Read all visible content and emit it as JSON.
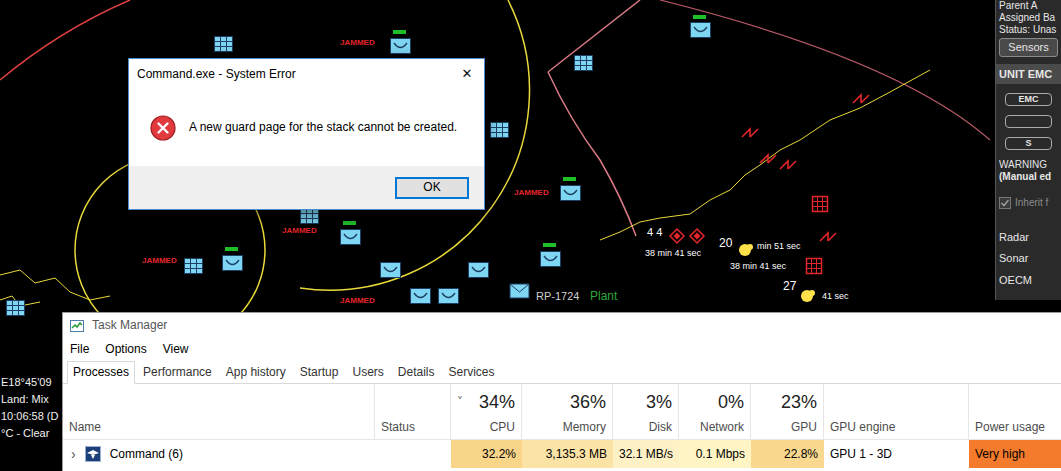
{
  "map": {
    "labels": [
      {
        "text": "JAMMED",
        "color": "#e3262b"
      },
      {
        "text": "JAMMED",
        "color": "#e3262b"
      },
      {
        "text": "JAMMED",
        "color": "#e3262b"
      },
      {
        "text": "JAMMED",
        "color": "#e3262b"
      },
      {
        "text": "JAMMED",
        "color": "#e3262b"
      },
      {
        "text": "RP-1724",
        "color": "#d0d0d0"
      },
      {
        "text": "Plant",
        "color": "#2fa83a"
      },
      {
        "text": "4 4",
        "color": "#ffffff"
      },
      {
        "text": "20",
        "color": "#ffffff"
      },
      {
        "text": "38 min 41 sec",
        "color": "#ffffff"
      },
      {
        "text": "38 min 41 sec",
        "color": "#ffffff"
      },
      {
        "text": "min 51 sec",
        "color": "#ffffff"
      },
      {
        "text": "27",
        "color": "#ffffff"
      },
      {
        "text": "41 sec",
        "color": "#ffffff"
      }
    ],
    "info": [
      "E18°45'09",
      "Land: Mix",
      "10:06:58 (D",
      "°C - Clear"
    ]
  },
  "unit_panel": {
    "lines": [
      "Parent A",
      "Assigned Ba",
      "Status: Unas"
    ],
    "sensors_button": "Sensors",
    "section": "UNIT EMC",
    "buttons": [
      "EMC",
      "",
      "S"
    ],
    "warning": "WARNING",
    "warning_note": "(Manual ed",
    "inherit": {
      "label": "Inherit f",
      "checked": true,
      "disabled": true
    },
    "rows": [
      "Radar",
      "Sonar",
      "OECM"
    ]
  },
  "dialog": {
    "title": "Command.exe - System Error",
    "close": "✕",
    "message": "A new guard page for the stack cannot be created.",
    "buttons": [
      "OK"
    ]
  },
  "task_manager": {
    "title": "Task Manager",
    "menu": [
      "File",
      "Options",
      "View"
    ],
    "tabs": [
      {
        "label": "Processes",
        "selected": true
      },
      {
        "label": "Performance",
        "selected": false
      },
      {
        "label": "App history",
        "selected": false
      },
      {
        "label": "Startup",
        "selected": false
      },
      {
        "label": "Users",
        "selected": false
      },
      {
        "label": "Details",
        "selected": false
      },
      {
        "label": "Services",
        "selected": false
      }
    ],
    "sort_indicator": "˅",
    "columns": [
      {
        "label": "Name",
        "sorted": false
      },
      {
        "label": "Status",
        "sorted": false
      },
      {
        "label": "CPU",
        "usage": "34%",
        "sorted": true
      },
      {
        "label": "Memory",
        "usage": "36%",
        "sorted": false
      },
      {
        "label": "Disk",
        "usage": "3%",
        "sorted": false
      },
      {
        "label": "Network",
        "usage": "0%",
        "sorted": false
      },
      {
        "label": "GPU",
        "usage": "23%",
        "sorted": false
      },
      {
        "label": "GPU engine",
        "sorted": false
      },
      {
        "label": "Power usage",
        "sorted": false
      }
    ],
    "rows": [
      {
        "expand": "›",
        "name": "Command (6)",
        "status": "",
        "cells": [
          {
            "text": "32.2%",
            "color": "#f9d58a"
          },
          {
            "text": "3,135.3 MB",
            "color": "#fbe3a6"
          },
          {
            "text": "32.1 MB/s",
            "color": "#fff1c6"
          },
          {
            "text": "0.1 Mbps",
            "color": "#fff4c4"
          },
          {
            "text": "22.8%",
            "color": "#fad88f"
          },
          {
            "text": "GPU 1 - 3D",
            "color": "#ffffff"
          },
          {
            "text": "Very high",
            "color": "#f47b2b"
          }
        ]
      }
    ]
  }
}
